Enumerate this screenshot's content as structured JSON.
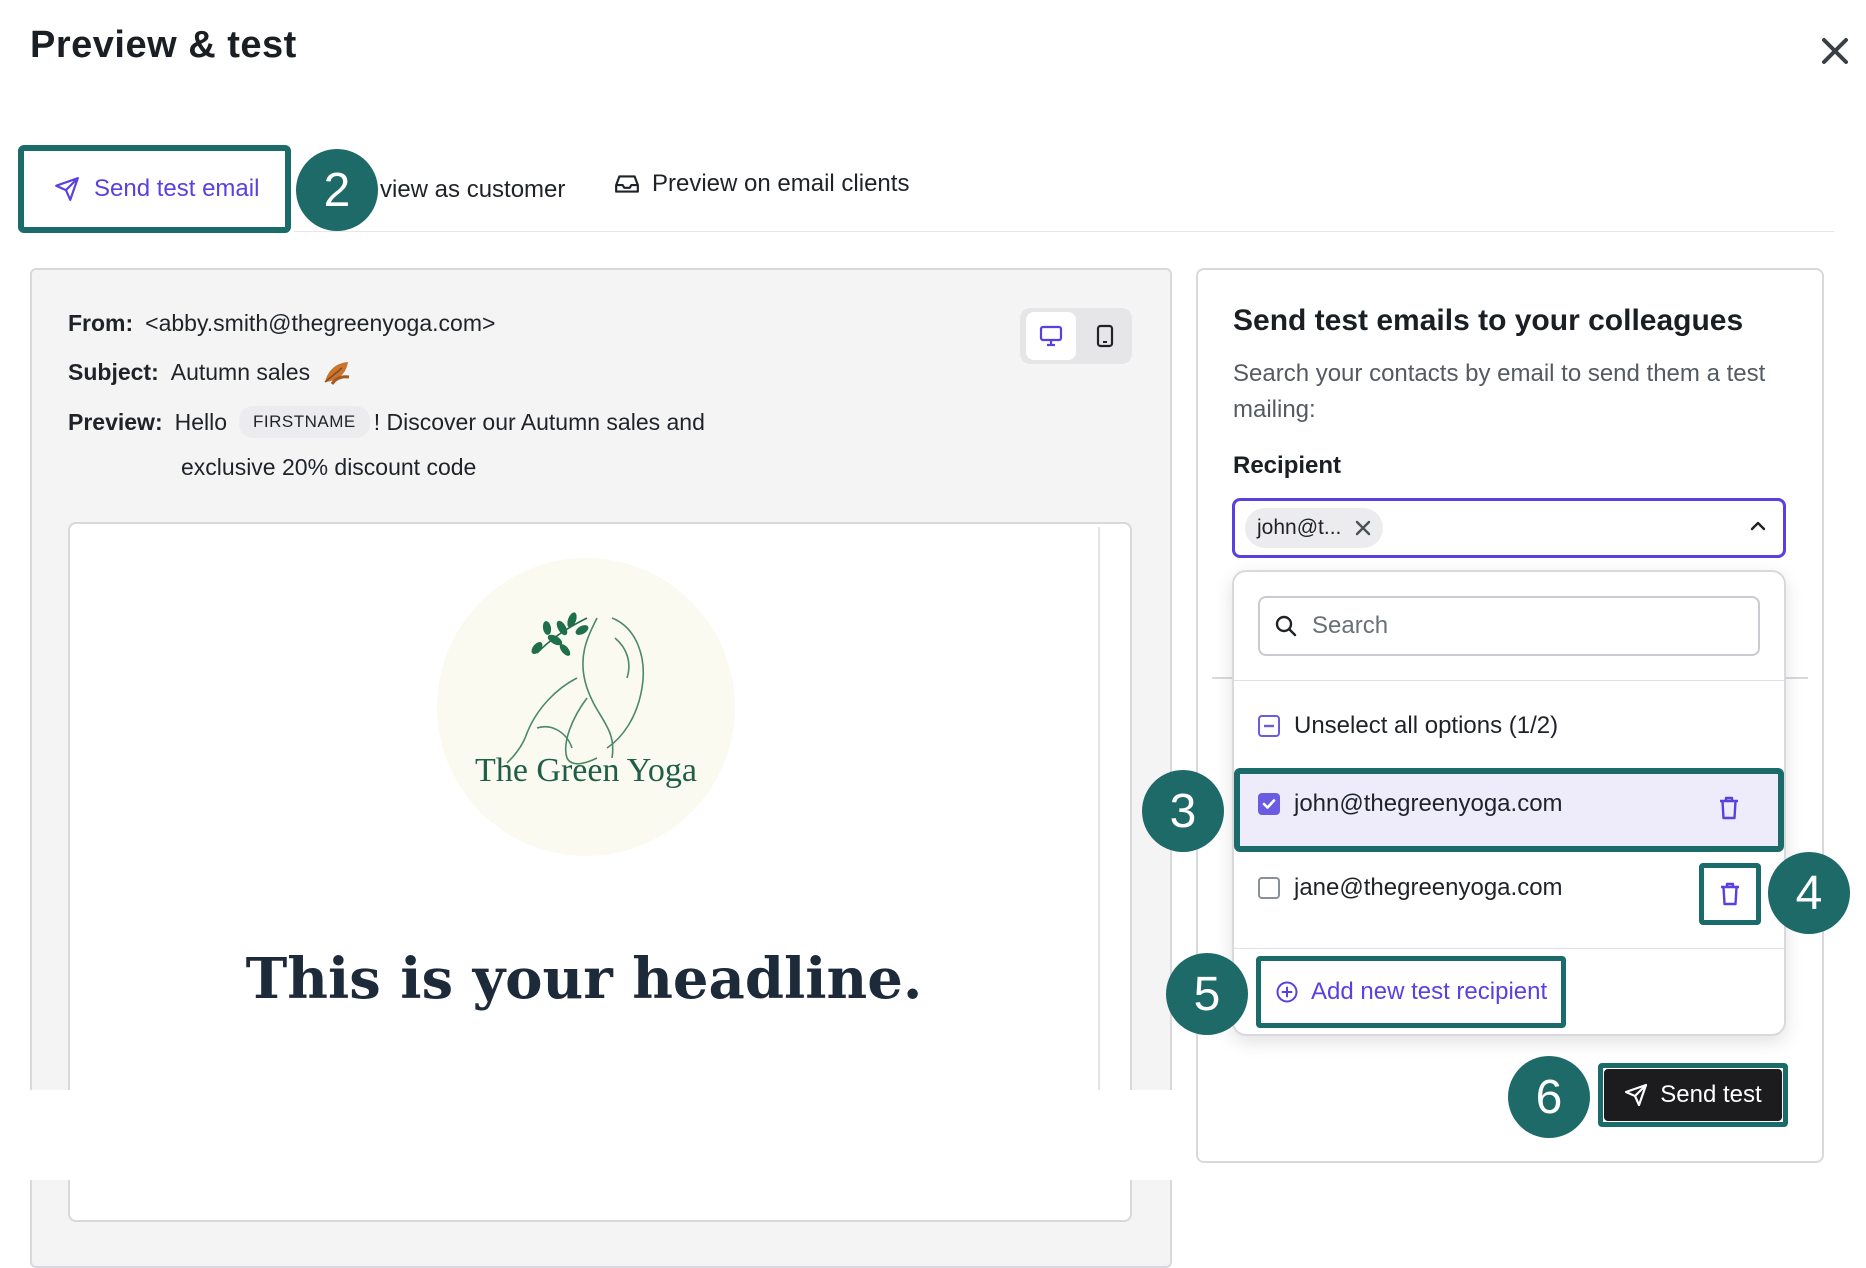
{
  "header": {
    "title": "Preview & test"
  },
  "tabs": {
    "send_test": "Send test email",
    "preview_customer": "view as customer",
    "preview_clients": "Preview on email clients"
  },
  "preview": {
    "from_label": "From:",
    "from_value": "<abby.smith@thegreenyoga.com>",
    "subject_label": "Subject:",
    "subject_value": "Autumn sales",
    "preview_label": "Preview:",
    "preview_hello": "Hello",
    "preview_token": "FIRSTNAME",
    "preview_rest": "! Discover our Autumn sales and",
    "preview_line2": "exclusive 20% discount code",
    "logo_text": "The Green Yoga",
    "headline": "This is your headline."
  },
  "test_panel": {
    "title": "Send test emails to your colleagues",
    "description": "Search your contacts by email to send them a test mailing:",
    "recipient_label": "Recipient",
    "selected_chip": "john@t...",
    "search_placeholder": "Search",
    "unselect_all": "Unselect all options (1/2)",
    "options": [
      {
        "email": "john@thegreenyoga.com",
        "checked": true
      },
      {
        "email": "jane@thegreenyoga.com",
        "checked": false
      }
    ],
    "add_recipient": "Add new test recipient",
    "send_button": "Send test"
  },
  "badges": {
    "b2": "2",
    "b3": "3",
    "b4": "4",
    "b5": "5",
    "b6": "6"
  },
  "colors": {
    "accent": "#5b3fe0",
    "highlight": "#1c6b6b",
    "badge": "#1d6a68",
    "selected_row": "#eeecfb",
    "send_button": "#1c1c1e"
  }
}
